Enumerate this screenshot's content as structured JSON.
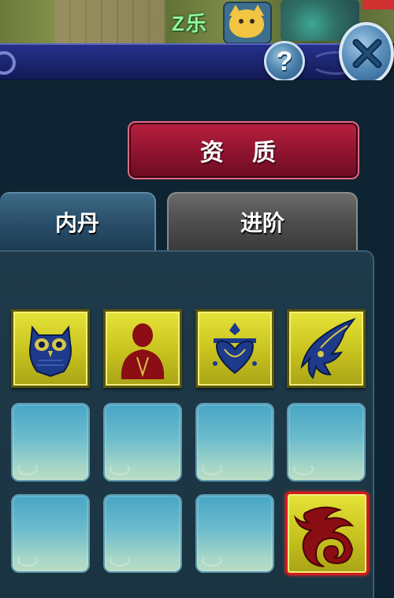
{
  "top_title": "Z乐",
  "header": {
    "help_label": "?"
  },
  "buttons": {
    "quality_label": "资 质"
  },
  "tabs": [
    {
      "label": "内丹"
    },
    {
      "label": "进阶"
    }
  ],
  "slots": [
    {
      "icon": "owl-icon"
    },
    {
      "icon": "figure-icon"
    },
    {
      "icon": "heart-crest-icon"
    },
    {
      "icon": "dragon-claw-icon"
    },
    {
      "icon": ""
    },
    {
      "icon": ""
    },
    {
      "icon": ""
    },
    {
      "icon": ""
    },
    {
      "icon": ""
    },
    {
      "icon": ""
    },
    {
      "icon": ""
    },
    {
      "icon": "cloud-swirl-icon",
      "selected": true
    }
  ],
  "colors": {
    "accent_red": "#8e1430",
    "slot_gold": "#c7c21e",
    "tab_blue": "#2a4f6a"
  }
}
